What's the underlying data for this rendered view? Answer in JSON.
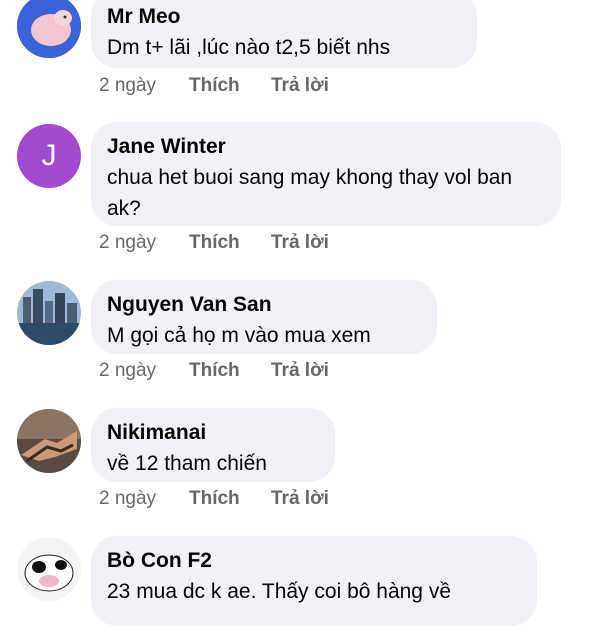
{
  "comments": [
    {
      "author": "Mr Meo",
      "text": "Dm t+ lãi ,lúc  nào t2,5 biết nhs",
      "time": "2 ngày",
      "like": "Thích",
      "reply": "Trả lời",
      "avatar": "pig-photo"
    },
    {
      "author": "Jane Winter",
      "text": "chua het buoi sang may khong thay vol ban ak?",
      "time": "2 ngày",
      "like": "Thích",
      "reply": "Trả lời",
      "avatar_letter": "J",
      "avatar_color": "#a24bd0"
    },
    {
      "author": "Nguyen Van San",
      "text": "M gọi cả họ m vào mua xem",
      "time": "2 ngày",
      "like": "Thích",
      "reply": "Trả lời",
      "avatar": "city-photo"
    },
    {
      "author": "Nikimanai",
      "text": "về 12 tham chiến",
      "time": "2 ngày",
      "like": "Thích",
      "reply": "Trả lời",
      "avatar": "handshake-photo"
    },
    {
      "author": "Bò Con F2",
      "text": "23 mua dc k ae. Thấy coi bô hàng về",
      "avatar": "cow-photo"
    }
  ],
  "colors": {
    "bubble": "#f0f2f5",
    "meta": "#65676b",
    "text": "#050505"
  }
}
